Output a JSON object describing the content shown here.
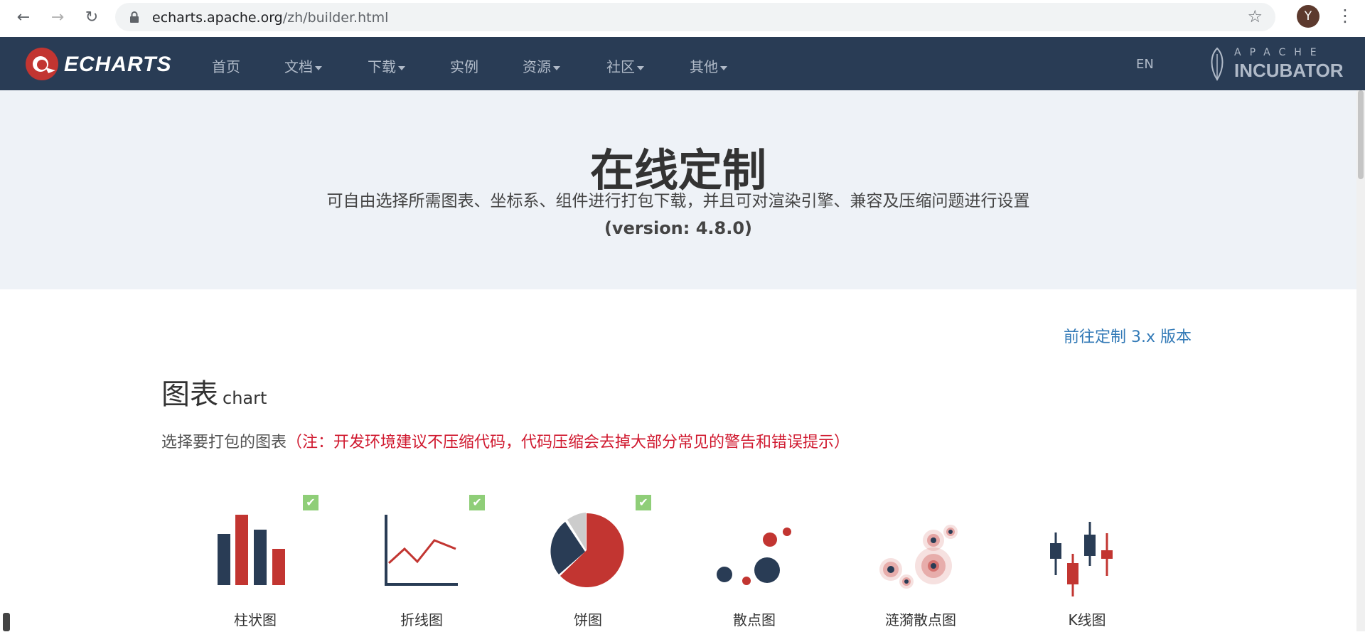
{
  "browser": {
    "url_host": "echarts.apache.org",
    "url_path": "/zh/builder.html",
    "avatar_letter": "Y"
  },
  "nav": {
    "logo_text": "ECHARTS",
    "items": [
      {
        "label": "首页",
        "dropdown": false
      },
      {
        "label": "文档",
        "dropdown": true
      },
      {
        "label": "下载",
        "dropdown": true
      },
      {
        "label": "实例",
        "dropdown": false
      },
      {
        "label": "资源",
        "dropdown": true
      },
      {
        "label": "社区",
        "dropdown": true
      },
      {
        "label": "其他",
        "dropdown": true
      }
    ],
    "lang": "EN",
    "incubator_top": "APACHE",
    "incubator_bottom": "INCUBATOR"
  },
  "hero": {
    "title": "在线定制",
    "description": "可自由选择所需图表、坐标系、组件进行打包下载，并且可对渲染引擎、兼容及压缩问题进行设置",
    "version": "(version: 4.8.0)"
  },
  "v3_link": "前往定制 3.x 版本",
  "chart_section": {
    "title": "图表",
    "subtitle": "chart",
    "desc": "选择要打包的图表",
    "warning": "（注：开发环境建议不压缩代码，代码压缩会去掉大部分常见的警告和错误提示）",
    "cards": [
      {
        "label": "柱状图",
        "selected": true,
        "icon": "bar-chart-icon"
      },
      {
        "label": "折线图",
        "selected": true,
        "icon": "line-chart-icon"
      },
      {
        "label": "饼图",
        "selected": true,
        "icon": "pie-chart-icon"
      },
      {
        "label": "散点图",
        "selected": false,
        "icon": "scatter-chart-icon"
      },
      {
        "label": "涟漪散点图",
        "selected": false,
        "icon": "effect-scatter-icon"
      },
      {
        "label": "K线图",
        "selected": false,
        "icon": "candlestick-icon"
      }
    ]
  },
  "colors": {
    "nav_bg": "#293c55",
    "hero_bg": "#eef2f7",
    "accent_red": "#c23531",
    "accent_navy": "#293c55",
    "link": "#337ab7",
    "warning": "#d0192f",
    "check": "#8fce78"
  }
}
